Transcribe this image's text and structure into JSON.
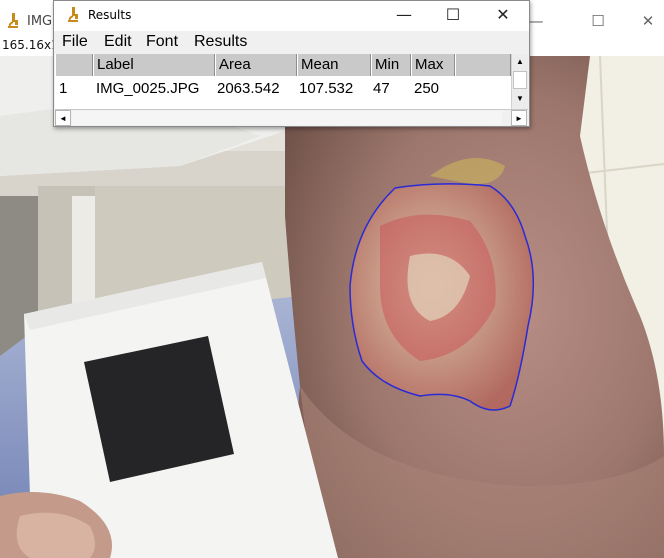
{
  "background_window": {
    "title": "IMG",
    "status_text": "165.16x1",
    "controls": {
      "minimize": "—",
      "maximize": "☐",
      "close": "✕"
    },
    "icon": "microscope-icon"
  },
  "results_window": {
    "title": "Results",
    "icon": "microscope-icon",
    "controls": {
      "minimize": "—",
      "maximize": "☐",
      "close": "✕"
    },
    "menu": [
      "File",
      "Edit",
      "Font",
      "Results"
    ],
    "table": {
      "columns": [
        "",
        "Label",
        "Area",
        "Mean",
        "Min",
        "Max"
      ],
      "rows": [
        [
          "1",
          "IMG_0025.JPG",
          "2063.542",
          "107.532",
          "47",
          "250"
        ]
      ]
    },
    "scroll": {
      "up": "▲",
      "down": "▼",
      "left": "◄",
      "right": "►"
    }
  },
  "colors": {
    "selection_outline": "#2a2ad6",
    "header_bg": "#c9c9c9"
  }
}
